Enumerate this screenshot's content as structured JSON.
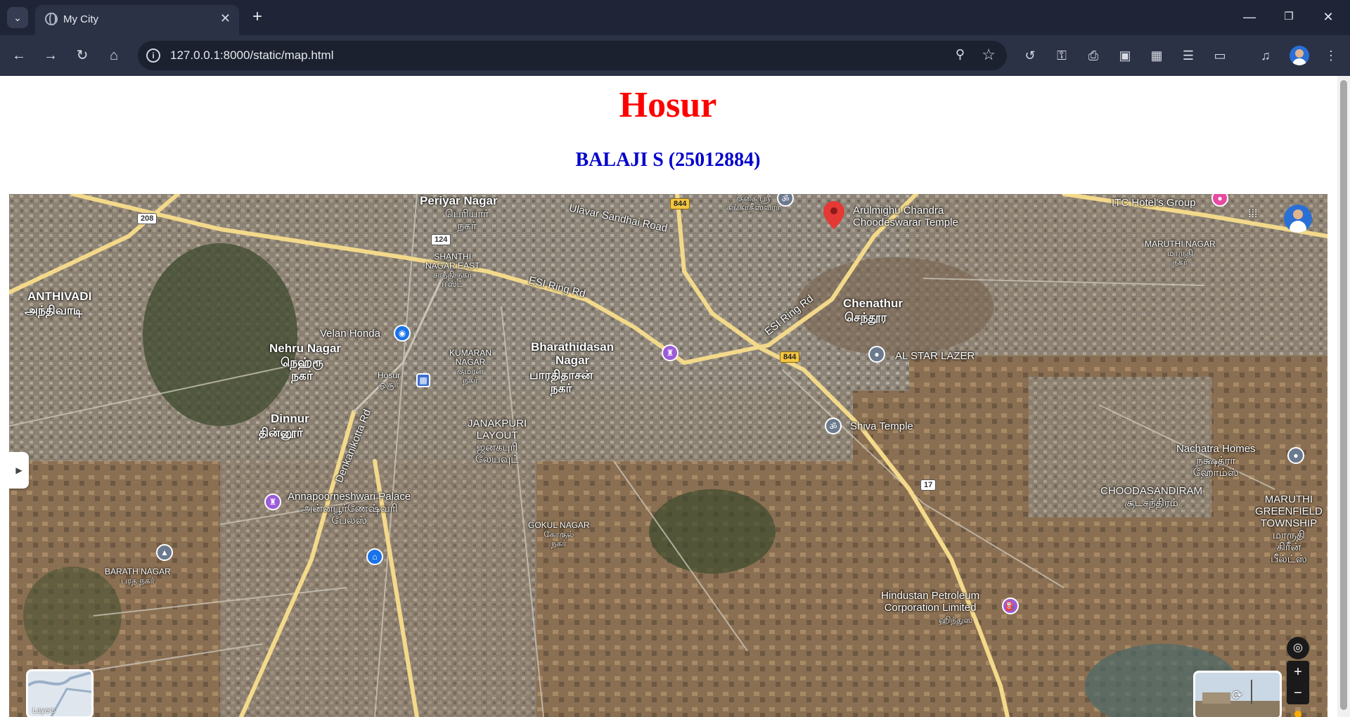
{
  "browser": {
    "tab_title": "My City",
    "url": "127.0.0.1:8000/static/map.html"
  },
  "page": {
    "title": "Hosur",
    "subtitle": "BALAJI S (25012884)"
  },
  "map": {
    "labels": {
      "periyar_nagar": "Periyar Nagar",
      "periyar_nagar_ta": "பெரியார்\nநகர்",
      "ulavar_sandhai_road": "Ulavar Sandhai Road",
      "arulmighu_temple": "Arulmighu Chandra\nChoodeswarar Temple",
      "itc_hotels": "ITC Hotel's Group",
      "maruthi_nagar": "MARUTHI NAGAR\nமாருதி\nநகர்",
      "shanthi_nagar_east": "SHANTHI\nNAGAR EAST\nசாந்தி நகர்\nஈஸ்ட்",
      "esi_ring_rd_1": "ESI Ring Rd",
      "esi_ring_rd_2": "ESI Ring Rd",
      "anthivadi": "ANTHIVADI",
      "anthivadi_ta": "அந்திவாடி",
      "chenathur": "Chenathur",
      "chenathur_ta": "செந்தூர",
      "velan_honda": "Velan Honda",
      "nehru_nagar": "Nehru Nagar",
      "nehru_nagar_ta": "நெஹ்ரூ\nநகர்",
      "kumaran_nagar": "KUMARAN\nNAGAR\nகுமரன்\nநகர்",
      "bharathidasan_nagar": "Bharathidasan\nNagar",
      "bharathidasan_nagar_ta": "பாரதிதாசன்\nநகர்",
      "al_star_lazer": "AL STAR LAZER",
      "hosur_station": "Hosur\nஓசூர்",
      "dinnur": "Dinnur",
      "dinnur_ta": "தின்னூர்",
      "janakpuri_layout": "JANAKPURI\nLAYOUT\nஜனகபுரி\nலேயவுட்",
      "shiva_temple": "Shiva Temple",
      "denkanikotta_rd": "Denkanikotta Rd",
      "nachatra_homes": "Nachatra Homes\nநக்ஷத்ரா\nஹோம்ஸ்",
      "annapoorneshwari_palace": "Annapoorneshwari Palace\nஅன்னபூர்ணேஷ்வரி\nபேலஸ்",
      "choodasandiram": "CHOODASANDIRAM\nசூடசந்திரம்",
      "maruthi_greenfield": "MARUTHI\nGREENFIELD\nTOWNSHIP\nமாருதி\nகிரீன்\nபீல்ட்ஸ்",
      "gokul_nagar": "GOKUL NAGAR\nகோகுல்\nநகர்",
      "barath_nagar": "BARATH NAGAR\nபரத நகர்",
      "hindustan_petroleum": "Hindustan Petroleum\nCorporation Limited",
      "hindustan_petroleum_ta": "ஹிந்துஸ",
      "top_ta": "குகை ஸ்ரீ\nகங்காதீஸ்வரர்"
    },
    "road_shields": {
      "nh208": "208",
      "r124": "124",
      "nh844_top": "844",
      "nh844_mid": "844",
      "r17": "17"
    },
    "icons": {
      "pin": "location-pin-icon",
      "temple": "om-icon",
      "shop": "shopping-bag-icon",
      "palace": "castle-icon",
      "train": "train-icon",
      "home": "home-icon",
      "fuel": "fuel-icon",
      "school": "school-icon"
    },
    "colors": {
      "road_major": "#f3d98a",
      "road_minor": "#c9c3b6",
      "title_red": "#ff0000",
      "subtitle_blue": "#0000cc",
      "pin_red": "#e53935",
      "poi_purple": "#9c5bd8",
      "poi_blue": "#1a73e8",
      "poi_grey": "#6b7a8f"
    },
    "layers_label": "Layers"
  }
}
